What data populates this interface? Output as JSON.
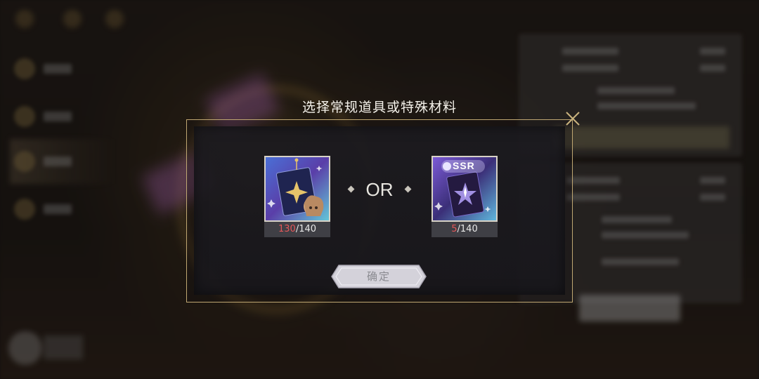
{
  "dialog": {
    "title": "选择常规道具或特殊材料",
    "or_text": "OR",
    "confirm_label": "确定"
  },
  "items": [
    {
      "current": "130",
      "max": "/140",
      "icon": "tarot-card-with-character"
    },
    {
      "current": "5",
      "max": "/140",
      "badge": "SSR",
      "icon": "ssr-crystal-card"
    }
  ],
  "colors": {
    "frame_gold": "#bfa772",
    "count_red": "#e6585a",
    "count_text": "#e9e9e9"
  }
}
